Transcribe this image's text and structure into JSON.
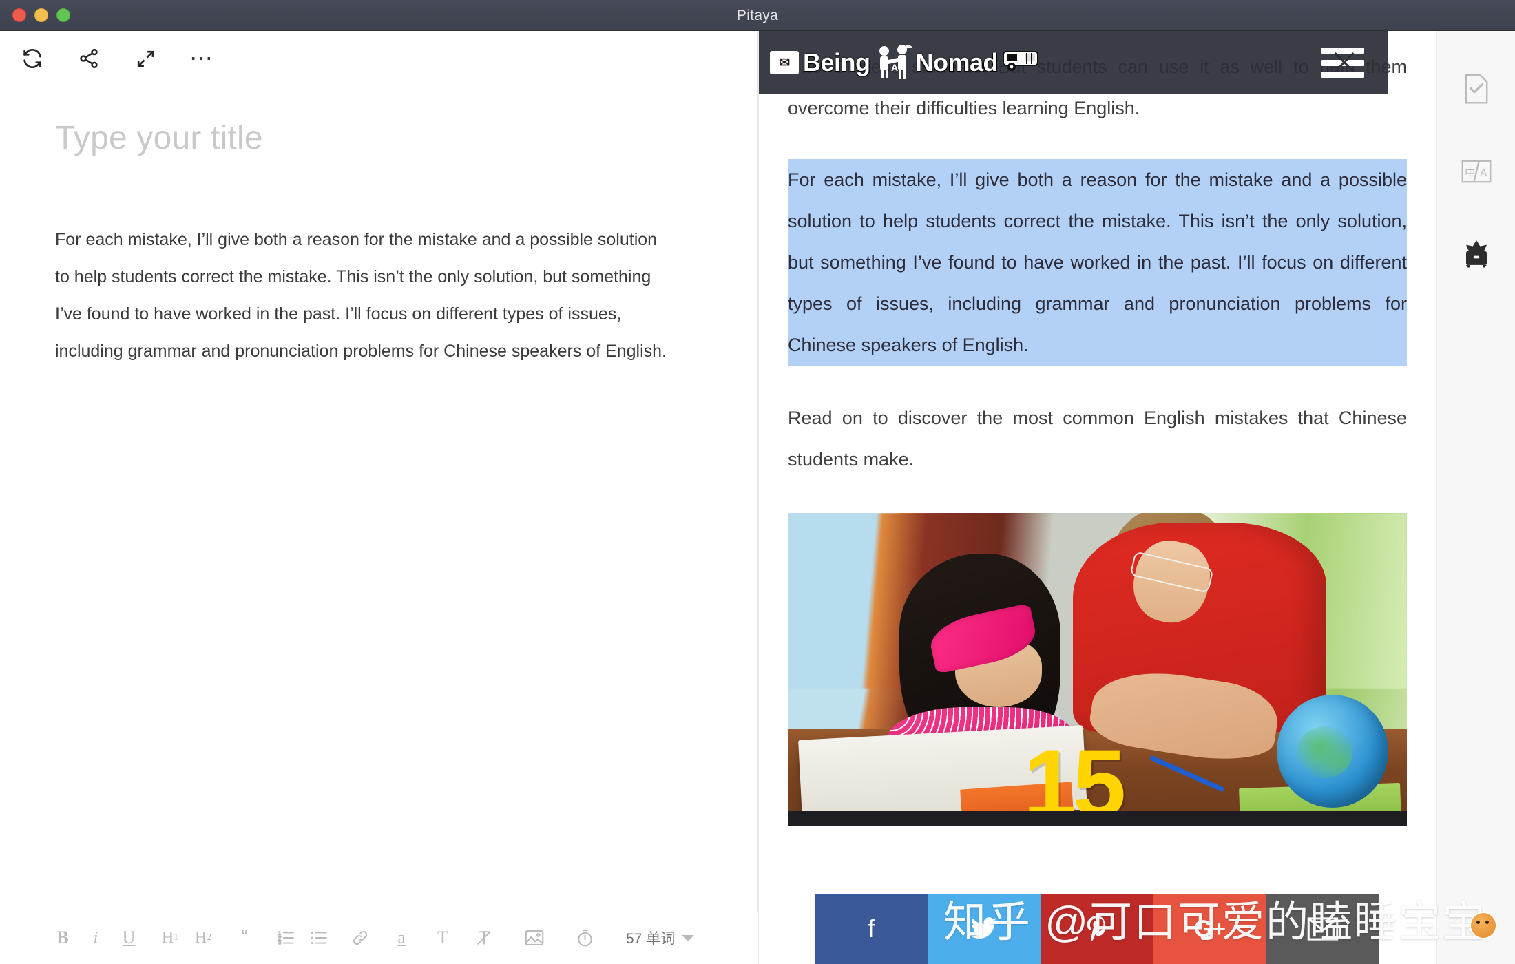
{
  "window": {
    "title": "Pitaya",
    "controls": [
      "close",
      "minimize",
      "maximize"
    ]
  },
  "editor": {
    "toolbar": [
      {
        "name": "sync-icon",
        "label": "Sync"
      },
      {
        "name": "share-icon",
        "label": "Share"
      },
      {
        "name": "fullscreen-icon",
        "label": "Fullscreen"
      },
      {
        "name": "more-icon",
        "label": "..."
      }
    ],
    "title_placeholder": "Type your title",
    "title_value": "",
    "body": "For each mistake, I’ll give both a reason for the mistake and a possible solution to help students correct the mistake. This isn’t the only solution, but something I’ve found to have worked in the past. I’ll focus on different types of issues, including grammar and pronunciation problems for Chinese speakers of English.",
    "format_bar": {
      "bold": "B",
      "italic": "i",
      "underline": "U",
      "heading1": "H",
      "heading1_sub": "1",
      "heading2": "H",
      "heading2_sub": "2",
      "blockquote": "“",
      "ordered_list": "ordered-list-icon",
      "unordered_list": "unordered-list-icon",
      "link": "link-icon",
      "highlight": "a",
      "text_style": "T",
      "clear_format": "clear-format-icon",
      "image": "image-icon",
      "timer": "timer-icon",
      "word_count": "57 单词"
    }
  },
  "preview": {
    "site_header": {
      "logo_text_1": "Being",
      "logo_text_2": "Nomad",
      "logo_badge": "✉",
      "logo_middle": "A",
      "menu": "hamburger-menu-icon"
    },
    "paragraph_top": "…to Chinese students. But students can use it as well to help them overcome their difficulties learning English.",
    "paragraph_highlighted": "For each mistake, I’ll give both a reason for the mistake and a possible solution to help students correct the mistake. This isn’t the only solution, but something I’ve found to have worked in the past. I’ll focus on different types of issues, including grammar and pronunciation problems for Chinese speakers of English.",
    "paragraph_after": "Read on to discover the most common English mistakes that Chinese students make.",
    "figure": {
      "caption_number": "15",
      "alt": "Teacher helping a young girl with her schoolwork at a desk with a globe"
    },
    "share_buttons": [
      {
        "name": "facebook-share-button",
        "glyph": "f",
        "color": "#3b5998"
      },
      {
        "name": "twitter-share-button",
        "glyph": "twitter-icon",
        "color": "#4daeec"
      },
      {
        "name": "pinterest-share-button",
        "glyph": "pinterest-icon",
        "color": "#bd2a27"
      },
      {
        "name": "googleplus-share-button",
        "glyph": "G+",
        "color": "#e6543f"
      },
      {
        "name": "email-share-button",
        "glyph": "envelope-icon",
        "color": "#5a5a5a"
      }
    ],
    "watermark": "知乎 @可口可爱的瞌睡宝宝"
  },
  "rail": {
    "items": [
      {
        "name": "document-check-icon",
        "label": "Proofread"
      },
      {
        "name": "translate-icon",
        "label": "中/A"
      },
      {
        "name": "archive-star-icon",
        "label": "Publish"
      }
    ]
  },
  "colors": {
    "titlebar": "#3e414e",
    "selection": "#b3d1f7",
    "site_header": "#2c2e38",
    "rail_bg": "#f7f7f7"
  }
}
